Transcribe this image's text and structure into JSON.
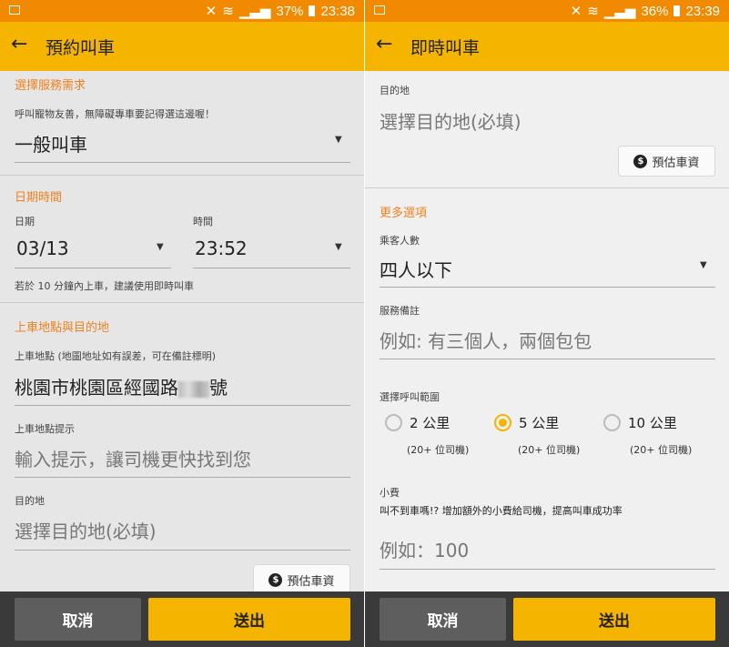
{
  "left": {
    "status": {
      "battery": "37%",
      "time": "23:38"
    },
    "title": "預約叫車",
    "service": {
      "section": "選擇服務需求",
      "hint": "呼叫寵物友善，無障礙專車要記得選這邊喔！",
      "value": "一般叫車"
    },
    "datetime": {
      "section": "日期時間",
      "date_label": "日期",
      "date_value": "03/13",
      "time_label": "時間",
      "time_value": "23:52",
      "hint": "若於 10 分鐘內上車，建議使用即時叫車"
    },
    "location": {
      "section": "上車地點與目的地",
      "pickup_label": "上車地點 (地圖地址如有誤差，可在備註標明)",
      "pickup_value_prefix": "桃園市桃園區經國路",
      "pickup_value_suffix": "號",
      "pickup_hint_label": "上車地點提示",
      "pickup_hint_placeholder": "輸入提示，讓司機更快找到您",
      "dest_label": "目的地",
      "dest_placeholder": "選擇目的地(必填)",
      "fare_button": "預估車資"
    },
    "cancel": "取消",
    "submit": "送出"
  },
  "right": {
    "status": {
      "battery": "36%",
      "time": "23:39"
    },
    "title": "即時叫車",
    "dest_label": "目的地",
    "dest_placeholder": "選擇目的地(必填)",
    "fare_button": "預估車資",
    "more": {
      "section": "更多選項",
      "passengers_label": "乘客人數",
      "passengers_value": "四人以下",
      "note_label": "服務備註",
      "note_placeholder": "例如: 有三個人，兩個包包",
      "range_label": "選擇呼叫範圍",
      "ranges": [
        {
          "label": "2 公里",
          "drivers": "(20+ 位司機)",
          "selected": false
        },
        {
          "label": "5 公里",
          "drivers": "(20+ 位司機)",
          "selected": true
        },
        {
          "label": "10 公里",
          "drivers": "(20+ 位司機)",
          "selected": false
        }
      ],
      "tip_label": "小費",
      "tip_hint": "叫不到車嗎!? 增加額外的小費給司機，提高叫車成功率",
      "tip_placeholder": "例如：100"
    },
    "cancel": "取消",
    "submit": "送出"
  },
  "colors": {
    "accent": "#f5b400",
    "status": "#f28a00",
    "section": "#ef8220"
  }
}
